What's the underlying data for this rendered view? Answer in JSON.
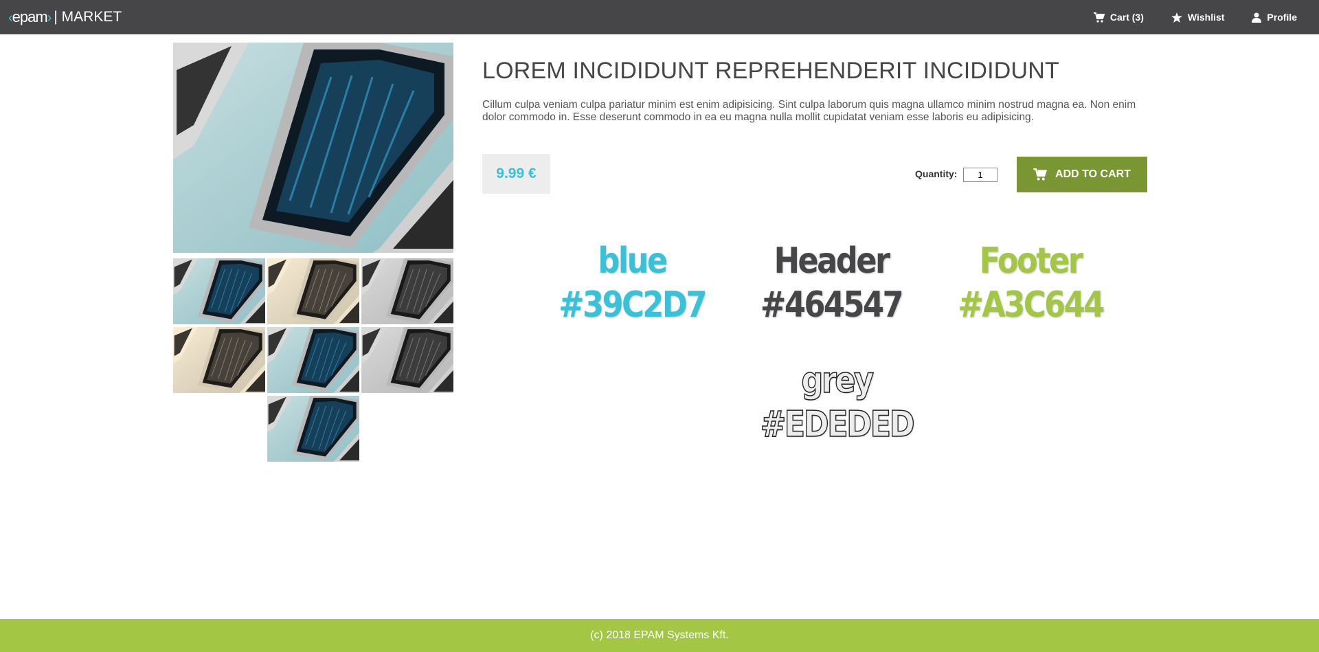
{
  "header": {
    "logo_text": "epam",
    "brand_text": "| MARKET",
    "nav": [
      {
        "label": "Cart (3)",
        "icon": "cart-icon"
      },
      {
        "label": "Wishlist",
        "icon": "star-icon"
      },
      {
        "label": "Profile",
        "icon": "user-icon"
      }
    ]
  },
  "product": {
    "title": "LOREM INCIDIDUNT REPREHENDERIT INCIDIDUNT",
    "description": "Cillum culpa veniam culpa pariatur minim est enim adipisicing. Sint culpa laborum quis magna ullamco minim nostrud magna ea. Non enim dolor commodo in. Esse deserunt commodo in ea eu magna nulla mollit cupidatat veniam esse laboris eu adipisicing.",
    "price": "9.99 €",
    "quantity_label": "Quantity:",
    "quantity_value": "1",
    "add_to_cart_label": "ADD TO CART"
  },
  "gallery": {
    "thumbnails": [
      "color",
      "sepia",
      "grayscale",
      "sepia",
      "color",
      "grayscale",
      "color"
    ]
  },
  "swatches": [
    {
      "name": "blue",
      "hex": "#39C2D7"
    },
    {
      "name": "Header",
      "hex": "#464547"
    },
    {
      "name": "Footer",
      "hex": "#A3C644"
    },
    {
      "name": "grey",
      "hex": "#EDEDED"
    }
  ],
  "footer": {
    "text": "(c) 2018 EPAM Systems Kft."
  },
  "colors": {
    "header_bg": "#464547",
    "footer_bg": "#A3C644",
    "accent_blue": "#39C2D7",
    "button_bg": "#7A9632",
    "price_bg": "#EDEDED"
  }
}
